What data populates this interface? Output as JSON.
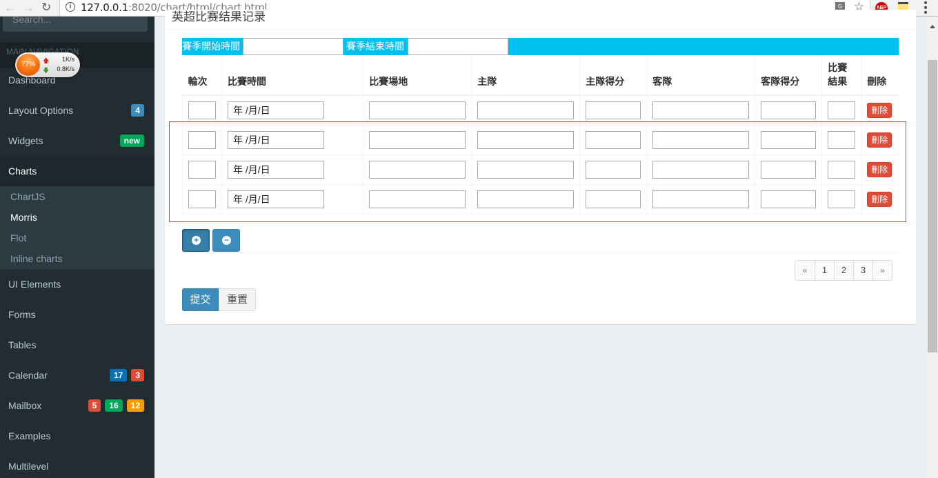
{
  "browser": {
    "url_host": "127.0.0.1",
    "url_rest": ":8020/chart/html/chart.html",
    "extensions": [
      "translate-icon",
      "bookmark-star-icon",
      "adblock-plus-icon",
      "notes-icon",
      "menu-icon"
    ],
    "abp_label": "ABP"
  },
  "net_widget": {
    "percent": "77%",
    "upload": "1K/s",
    "download": "0.8K/s"
  },
  "sidebar": {
    "search_placeholder": "Search...",
    "header": "MAIN NAVIGATION",
    "items": [
      {
        "label": "Dashboard"
      },
      {
        "label": "Layout Options",
        "badges": [
          {
            "text": "4",
            "color": "#3c8dbc"
          }
        ]
      },
      {
        "label": "Widgets",
        "badges": [
          {
            "text": "new",
            "color": "#00a65a"
          }
        ]
      },
      {
        "label": "Charts",
        "active": true
      },
      {
        "label": "UI Elements"
      },
      {
        "label": "Forms"
      },
      {
        "label": "Tables"
      },
      {
        "label": "Calendar",
        "badges": [
          {
            "text": "17",
            "color": "#0073b7"
          },
          {
            "text": "3",
            "color": "#dd4b39"
          }
        ]
      },
      {
        "label": "Mailbox",
        "badges": [
          {
            "text": "5",
            "color": "#dd4b39"
          },
          {
            "text": "16",
            "color": "#00a65a"
          },
          {
            "text": "12",
            "color": "#f39c12"
          }
        ]
      },
      {
        "label": "Examples"
      },
      {
        "label": "Multilevel"
      }
    ],
    "submenu": [
      {
        "label": "ChartJS"
      },
      {
        "label": "Morris",
        "active": true
      },
      {
        "label": "Flot"
      },
      {
        "label": "Inline charts"
      }
    ]
  },
  "main": {
    "box_title": "英超比赛结果记录",
    "season_start_label": "賽季開始時間",
    "season_start_value": "",
    "season_end_label": "賽季結束時間",
    "season_end_value": "",
    "columns": [
      "輪次",
      "比賽時間",
      "比賽場地",
      "主隊",
      "主隊得分",
      "客隊",
      "客隊得分",
      "比賽\n結果",
      "刪除"
    ],
    "rows": [
      {
        "round": "",
        "date": "年 /月/日",
        "venue": "",
        "home": "",
        "home_score": "",
        "away": "",
        "away_score": "",
        "result": "",
        "delete_label": "刪除"
      },
      {
        "round": "",
        "date": "年 /月/日",
        "venue": "",
        "home": "",
        "home_score": "",
        "away": "",
        "away_score": "",
        "result": "",
        "delete_label": "刪除"
      },
      {
        "round": "",
        "date": "年 /月/日",
        "venue": "",
        "home": "",
        "home_score": "",
        "away": "",
        "away_score": "",
        "result": "",
        "delete_label": "刪除"
      },
      {
        "round": "",
        "date": "年 /月/日",
        "venue": "",
        "home": "",
        "home_score": "",
        "away": "",
        "away_score": "",
        "result": "",
        "delete_label": "刪除"
      }
    ],
    "add_row_icon": "plus-circle-icon",
    "remove_row_icon": "minus-circle-icon",
    "pagination": [
      "«",
      "1",
      "2",
      "3",
      "»"
    ],
    "submit_label": "提交",
    "reset_label": "重置",
    "accent_color": "#00c0ef",
    "primary_color": "#3c8dbc",
    "danger_color": "#dd4b39"
  }
}
